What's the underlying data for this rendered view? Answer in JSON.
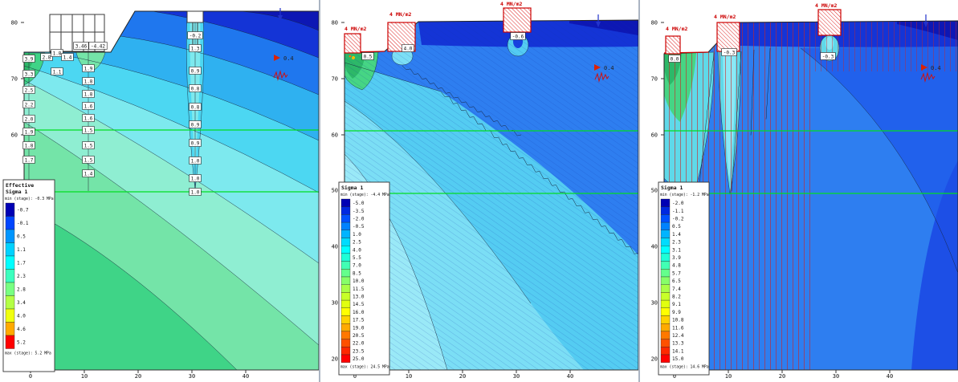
{
  "colors": {
    "green_line": "#00dd22",
    "load": "#cc0000",
    "axis": "#333333"
  },
  "chart_data": [
    {
      "type": "heatmap",
      "name": "effective-sigma-1-contours",
      "legend": {
        "title_lines": [
          "Effective",
          "Sigma 1"
        ],
        "min_label": "min (stage): -0.3 MPa",
        "max_label": "max (stage): 5.2 MPa",
        "entries": [
          {
            "label": "-0.7",
            "color": "#0000b4"
          },
          {
            "label": "-0.1",
            "color": "#0046ff"
          },
          {
            "label": "0.5",
            "color": "#0096ff"
          },
          {
            "label": "1.1",
            "color": "#00d2ff"
          },
          {
            "label": "1.7",
            "color": "#00ffff"
          },
          {
            "label": "2.3",
            "color": "#3cffbe"
          },
          {
            "label": "2.8",
            "color": "#78ff82"
          },
          {
            "label": "3.4",
            "color": "#b4ff46"
          },
          {
            "label": "4.0",
            "color": "#f0ff0f"
          },
          {
            "label": "4.6",
            "color": "#ffaa00"
          },
          {
            "label": "5.2",
            "color": "#ff0000"
          }
        ]
      },
      "x_ticks": [
        "0",
        "10",
        "20",
        "30",
        "40"
      ],
      "y_ticks": [
        "80",
        "70",
        "60",
        "50",
        "40",
        "30",
        "20"
      ],
      "arrow_label": "0.4",
      "load_labels": [],
      "value_boxes": [
        {
          "x": 36,
          "y": 73,
          "v": "3.9"
        },
        {
          "x": 36,
          "y": 92,
          "v": "3.3"
        },
        {
          "x": 36,
          "y": 112,
          "v": "2.5"
        },
        {
          "x": 36,
          "y": 130,
          "v": "2.2"
        },
        {
          "x": 36,
          "y": 148,
          "v": "2.0"
        },
        {
          "x": 36,
          "y": 164,
          "v": "1.9"
        },
        {
          "x": 36,
          "y": 181,
          "v": "1.8"
        },
        {
          "x": 36,
          "y": 199,
          "v": "1.7"
        },
        {
          "x": 36,
          "y": 235,
          "v": "1.9"
        },
        {
          "x": 58,
          "y": 71,
          "v": "2.8"
        },
        {
          "x": 71,
          "y": 66,
          "v": "1.8"
        },
        {
          "x": 84,
          "y": 71,
          "v": "1.4"
        },
        {
          "x": 71,
          "y": 89,
          "v": "1.1"
        },
        {
          "x": 101,
          "y": 57,
          "v": "3.46"
        },
        {
          "x": 122,
          "y": 57,
          "v": "-4.42"
        },
        {
          "x": 110,
          "y": 85,
          "v": "1.9"
        },
        {
          "x": 110,
          "y": 101,
          "v": "1.8"
        },
        {
          "x": 110,
          "y": 117,
          "v": "1.8"
        },
        {
          "x": 110,
          "y": 132,
          "v": "1.6"
        },
        {
          "x": 110,
          "y": 147,
          "v": "1.6"
        },
        {
          "x": 110,
          "y": 162,
          "v": "1.5"
        },
        {
          "x": 110,
          "y": 181,
          "v": "1.5"
        },
        {
          "x": 110,
          "y": 199,
          "v": "1.5"
        },
        {
          "x": 110,
          "y": 216,
          "v": "1.4"
        },
        {
          "x": 243,
          "y": 44,
          "v": "-0.2"
        },
        {
          "x": 243,
          "y": 60,
          "v": "1.3"
        },
        {
          "x": 243,
          "y": 88,
          "v": "0.9"
        },
        {
          "x": 243,
          "y": 110,
          "v": "0.8"
        },
        {
          "x": 243,
          "y": 133,
          "v": "0.8"
        },
        {
          "x": 243,
          "y": 155,
          "v": "0.9"
        },
        {
          "x": 243,
          "y": 178,
          "v": "0.9"
        },
        {
          "x": 243,
          "y": 200,
          "v": "1.0"
        },
        {
          "x": 243,
          "y": 222,
          "v": "1.0"
        },
        {
          "x": 243,
          "y": 239,
          "v": "1.0"
        }
      ]
    },
    {
      "type": "heatmap",
      "name": "sigma-1-contours-stage-2",
      "legend": {
        "title_lines": [
          "Sigma 1"
        ],
        "min_label": "min (stage): -4.4 MPa",
        "max_label": "max (stage): 24.5 MPa",
        "entries": [
          {
            "label": "-5.0",
            "color": "#0000b4"
          },
          {
            "label": "-3.5",
            "color": "#0028e1"
          },
          {
            "label": "-2.0",
            "color": "#0050ff"
          },
          {
            "label": "-0.5",
            "color": "#0082ff"
          },
          {
            "label": "1.0",
            "color": "#00b4ff"
          },
          {
            "label": "2.5",
            "color": "#00dcff"
          },
          {
            "label": "4.0",
            "color": "#00ffff"
          },
          {
            "label": "5.5",
            "color": "#1effd7"
          },
          {
            "label": "7.0",
            "color": "#41ffb4"
          },
          {
            "label": "8.5",
            "color": "#64ff8c"
          },
          {
            "label": "10.0",
            "color": "#87ff69"
          },
          {
            "label": "11.5",
            "color": "#aaff46"
          },
          {
            "label": "13.0",
            "color": "#c8ff28"
          },
          {
            "label": "14.5",
            "color": "#e1ff0f"
          },
          {
            "label": "16.0",
            "color": "#ffff00"
          },
          {
            "label": "17.5",
            "color": "#ffd200"
          },
          {
            "label": "19.0",
            "color": "#ffaa00"
          },
          {
            "label": "20.5",
            "color": "#ff7800"
          },
          {
            "label": "22.0",
            "color": "#ff5000"
          },
          {
            "label": "23.5",
            "color": "#ff2800"
          },
          {
            "label": "25.0",
            "color": "#ff0000"
          }
        ]
      },
      "x_ticks": [
        "0",
        "10",
        "20",
        "30",
        "40"
      ],
      "y_ticks": [
        "80",
        "70",
        "60",
        "50",
        "40",
        "30",
        "20"
      ],
      "arrow_label": "0.4",
      "load_labels": [
        {
          "x": 30,
          "y": 38,
          "v": "4 MN/m2"
        },
        {
          "x": 86,
          "y": 20,
          "v": "4 MN/m2"
        },
        {
          "x": 224,
          "y": 7,
          "v": "4 MN/m2"
        }
      ],
      "value_boxes": [
        {
          "x": 59,
          "y": 70,
          "v": "0.5"
        },
        {
          "x": 109,
          "y": 60,
          "v": "4.0"
        },
        {
          "x": 246,
          "y": 45,
          "v": "-0.6"
        }
      ]
    },
    {
      "type": "heatmap",
      "name": "sigma-1-contours-stage-3",
      "legend": {
        "title_lines": [
          "Sigma 1"
        ],
        "min_label": "min (stage): -1.2 MPa",
        "max_label": "max (stage): 14.6 MPa",
        "entries": [
          {
            "label": "-2.0",
            "color": "#0000b4"
          },
          {
            "label": "-1.1",
            "color": "#0028e1"
          },
          {
            "label": "-0.2",
            "color": "#0050ff"
          },
          {
            "label": "0.5",
            "color": "#0082ff"
          },
          {
            "label": "1.4",
            "color": "#00b4ff"
          },
          {
            "label": "2.3",
            "color": "#00dcff"
          },
          {
            "label": "3.1",
            "color": "#00ffff"
          },
          {
            "label": "3.9",
            "color": "#1effd7"
          },
          {
            "label": "4.8",
            "color": "#41ffb4"
          },
          {
            "label": "5.7",
            "color": "#64ff8c"
          },
          {
            "label": "6.5",
            "color": "#87ff69"
          },
          {
            "label": "7.4",
            "color": "#aaff46"
          },
          {
            "label": "8.2",
            "color": "#c8ff28"
          },
          {
            "label": "9.1",
            "color": "#e1ff0f"
          },
          {
            "label": "9.9",
            "color": "#ffff00"
          },
          {
            "label": "10.8",
            "color": "#ffd200"
          },
          {
            "label": "11.6",
            "color": "#ffaa00"
          },
          {
            "label": "12.4",
            "color": "#ff7800"
          },
          {
            "label": "13.3",
            "color": "#ff5000"
          },
          {
            "label": "14.1",
            "color": "#ff2800"
          },
          {
            "label": "15.0",
            "color": "#ff0000"
          }
        ]
      },
      "x_ticks": [
        "0",
        "10",
        "20",
        "30",
        "40"
      ],
      "y_ticks": [
        "80",
        "70",
        "60",
        "50",
        "40",
        "30",
        "20"
      ],
      "arrow_label": "0.4",
      "load_labels": [
        {
          "x": 32,
          "y": 38,
          "v": "4 MN/m2"
        },
        {
          "x": 92,
          "y": 23,
          "v": "4 MN/m2"
        },
        {
          "x": 218,
          "y": 9,
          "v": "4 MN/m2"
        }
      ],
      "value_boxes": [
        {
          "x": 43,
          "y": 73,
          "v": "0.0"
        },
        {
          "x": 111,
          "y": 65,
          "v": "-0.3"
        },
        {
          "x": 234,
          "y": 70,
          "v": "-0.3"
        }
      ]
    }
  ]
}
